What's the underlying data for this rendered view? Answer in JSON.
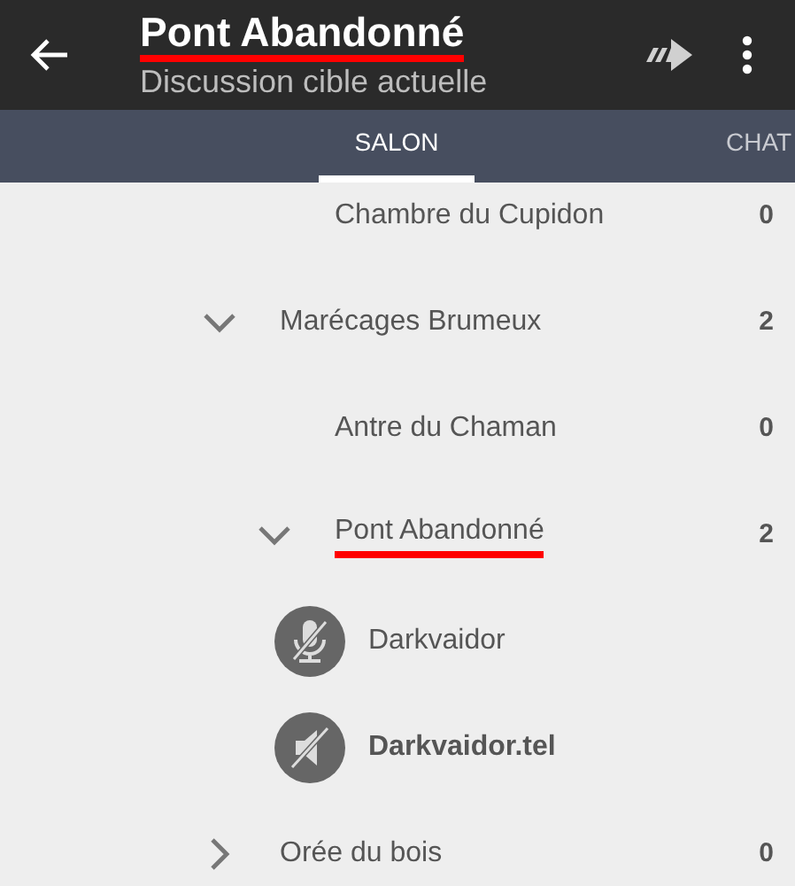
{
  "app_bar": {
    "title": "Pont Abandonné",
    "title_highlighted": true,
    "subtitle": "Discussion cible actuelle"
  },
  "tabs": [
    {
      "label": "SALON",
      "selected": true
    },
    {
      "label": "CHAT",
      "selected": false
    }
  ],
  "channels": [
    {
      "children": [
        {
          "name": "Chambre du Cupidon",
          "count": "0",
          "highlighted": false
        }
      ]
    },
    {
      "name": "Marécages Brumeux",
      "count": "2",
      "expanded": true,
      "highlighted": false,
      "children": [
        {
          "name": "Antre du Chaman",
          "count": "0",
          "highlighted": false
        },
        {
          "name": "Pont Abandonné",
          "count": "2",
          "expanded": true,
          "highlighted": true,
          "users": [
            {
              "name": "Darkvaidor",
              "kind": "muted",
              "is_self": false
            },
            {
              "name": "Darkvaidor.tel",
              "kind": "deafened",
              "is_self": true
            }
          ]
        }
      ]
    },
    {
      "name": "Orée du bois",
      "count": "0",
      "expanded": false,
      "highlighted": false
    }
  ]
}
